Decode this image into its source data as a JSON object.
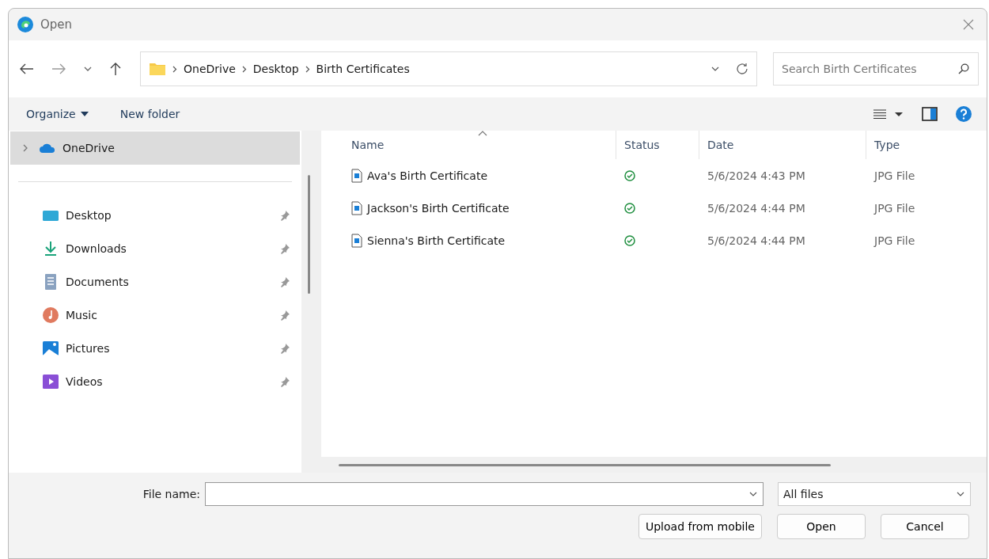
{
  "window": {
    "title": "Open"
  },
  "address": {
    "crumbs": [
      "OneDrive",
      "Desktop",
      "Birth Certificates"
    ]
  },
  "search": {
    "placeholder": "Search Birth Certificates"
  },
  "toolbar": {
    "organize": "Organize",
    "new_folder": "New folder"
  },
  "sidebar": {
    "items": [
      {
        "label": "OneDrive",
        "kind": "cloud",
        "selected": true,
        "expanded": false
      },
      {
        "label": "Desktop",
        "kind": "desktop",
        "selected": false
      },
      {
        "label": "Downloads",
        "kind": "downloads",
        "selected": false
      },
      {
        "label": "Documents",
        "kind": "documents",
        "selected": false
      },
      {
        "label": "Music",
        "kind": "music",
        "selected": false
      },
      {
        "label": "Pictures",
        "kind": "pictures",
        "selected": false
      },
      {
        "label": "Videos",
        "kind": "videos",
        "selected": false
      }
    ]
  },
  "table": {
    "columns": [
      "Name",
      "Status",
      "Date",
      "Type"
    ],
    "rows": [
      {
        "name": "Ava's Birth Certificate",
        "synced": true,
        "date": "5/6/2024 4:43 PM",
        "type": "JPG File",
        "selected": false
      },
      {
        "name": "Jackson's Birth Certificate",
        "synced": true,
        "date": "5/6/2024 4:44 PM",
        "type": "JPG File",
        "selected": false
      },
      {
        "name": "Sienna's Birth Certificate",
        "synced": true,
        "date": "5/6/2024 4:44 PM",
        "type": "JPG File",
        "selected": false
      }
    ]
  },
  "footer": {
    "file_name_label": "File name:",
    "file_type": "All files",
    "buttons": [
      "Upload from mobile",
      "Open",
      "Cancel"
    ]
  }
}
